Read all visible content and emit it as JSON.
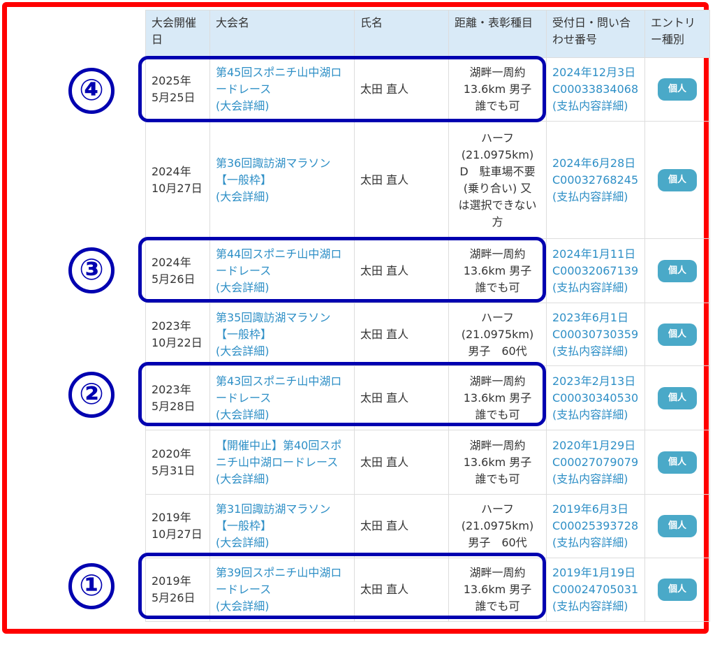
{
  "headers": {
    "date": "大会開催日",
    "event": "大会名",
    "name": "氏名",
    "distance": "距離・表彰種目",
    "receipt": "受付日・問い合わせ番号",
    "entry_type": "エントリー種別"
  },
  "rows": [
    {
      "year": "2025年",
      "day": "5月25日",
      "event_lines": [
        "第45回スポニチ山中湖ロ",
        "ードレース"
      ],
      "details_link": "(大会詳細)",
      "name": "太田 直人",
      "distance_lines": [
        "湖畔一周約",
        "13.6km 男子",
        "誰でも可"
      ],
      "receipt_date": "2024年12月3日",
      "receipt_no": "C00033834068",
      "payment_link": "(支払内容詳細)",
      "entry_type": "個人"
    },
    {
      "year": "2024年",
      "day": "10月27日",
      "event_lines": [
        "第36回諏訪湖マラソン",
        "【一般枠】"
      ],
      "details_link": "(大会詳細)",
      "name": "太田 直人",
      "distance_lines": [
        "ハーフ",
        "(21.0975km)",
        "D　駐車場不要",
        "(乗り合い) 又",
        "は選択できない",
        "方"
      ],
      "receipt_date": "2024年6月28日",
      "receipt_no": "C00032768245",
      "payment_link": "(支払内容詳細)",
      "entry_type": "個人"
    },
    {
      "year": "2024年",
      "day": "5月26日",
      "event_lines": [
        "第44回スポニチ山中湖ロ",
        "ードレース"
      ],
      "details_link": "(大会詳細)",
      "name": "太田 直人",
      "distance_lines": [
        "湖畔一周約",
        "13.6km 男子",
        "誰でも可"
      ],
      "receipt_date": "2024年1月11日",
      "receipt_no": "C00032067139",
      "payment_link": "(支払内容詳細)",
      "entry_type": "個人"
    },
    {
      "year": "2023年",
      "day": "10月22日",
      "event_lines": [
        "第35回諏訪湖マラソン",
        "【一般枠】"
      ],
      "details_link": "(大会詳細)",
      "name": "太田 直人",
      "distance_lines": [
        "ハーフ",
        "(21.0975km)",
        "男子　60代"
      ],
      "receipt_date": "2023年6月1日",
      "receipt_no": "C00030730359",
      "payment_link": "(支払内容詳細)",
      "entry_type": "個人"
    },
    {
      "year": "2023年",
      "day": "5月28日",
      "event_lines": [
        "第43回スポニチ山中湖ロ",
        "ードレース"
      ],
      "details_link": "(大会詳細)",
      "name": "太田 直人",
      "distance_lines": [
        "湖畔一周約",
        "13.6km 男子",
        "誰でも可"
      ],
      "receipt_date": "2023年2月13日",
      "receipt_no": "C00030340530",
      "payment_link": "(支払内容詳細)",
      "entry_type": "個人"
    },
    {
      "year": "2020年",
      "day": "5月31日",
      "event_lines": [
        "【開催中止】第40回スポ",
        "ニチ山中湖ロードレース"
      ],
      "details_link": "(大会詳細)",
      "name": "太田 直人",
      "distance_lines": [
        "湖畔一周約",
        "13.6km 男子",
        "誰でも可"
      ],
      "receipt_date": "2020年1月29日",
      "receipt_no": "C00027079079",
      "payment_link": "(支払内容詳細)",
      "entry_type": "個人"
    },
    {
      "year": "2019年",
      "day": "10月27日",
      "event_lines": [
        "第31回諏訪湖マラソン",
        "【一般枠】"
      ],
      "details_link": "(大会詳細)",
      "name": "太田 直人",
      "distance_lines": [
        "ハーフ",
        "(21.0975km)",
        "男子　60代"
      ],
      "receipt_date": "2019年6月3日",
      "receipt_no": "C00025393728",
      "payment_link": "(支払内容詳細)",
      "entry_type": "個人"
    },
    {
      "year": "2019年",
      "day": "5月26日",
      "event_lines": [
        "第39回スポニチ山中湖ロ",
        "ードレース"
      ],
      "details_link": "(大会詳細)",
      "name": "太田 直人",
      "distance_lines": [
        "湖畔一周約",
        "13.6km 男子",
        "誰でも可"
      ],
      "receipt_date": "2019年1月19日",
      "receipt_no": "C00024705031",
      "payment_link": "(支払内容詳細)",
      "entry_type": "個人"
    }
  ],
  "markers": [
    "④",
    "③",
    "②",
    "①"
  ],
  "colors": {
    "frame": "#ff0000",
    "highlight": "#0000b0",
    "header_bg": "#d9eaf7",
    "link": "#2e8fc6",
    "badge": "#4aa9c8"
  }
}
